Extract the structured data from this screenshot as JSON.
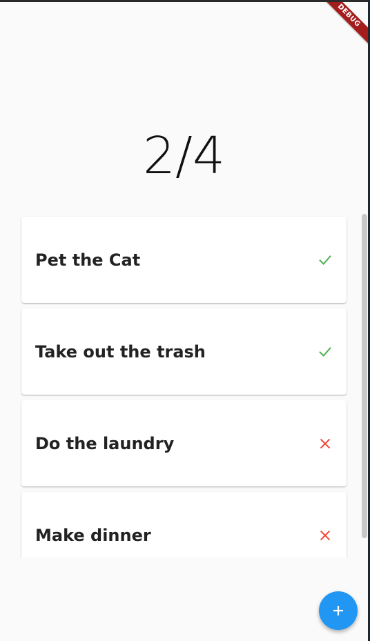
{
  "counter": "2/4",
  "debug_banner": "DEBUG",
  "tasks": [
    {
      "label": "Pet the Cat",
      "status": "done",
      "icon": "check-icon",
      "color": "#4caf50"
    },
    {
      "label": "Take out the trash",
      "status": "done",
      "icon": "check-icon",
      "color": "#4caf50"
    },
    {
      "label": "Do the laundry",
      "status": "not-done",
      "icon": "close-icon",
      "color": "#f44336"
    },
    {
      "label": "Make dinner",
      "status": "not-done",
      "icon": "close-icon",
      "color": "#f44336"
    }
  ],
  "fab": {
    "icon": "plus-icon",
    "color": "#2196f3"
  }
}
